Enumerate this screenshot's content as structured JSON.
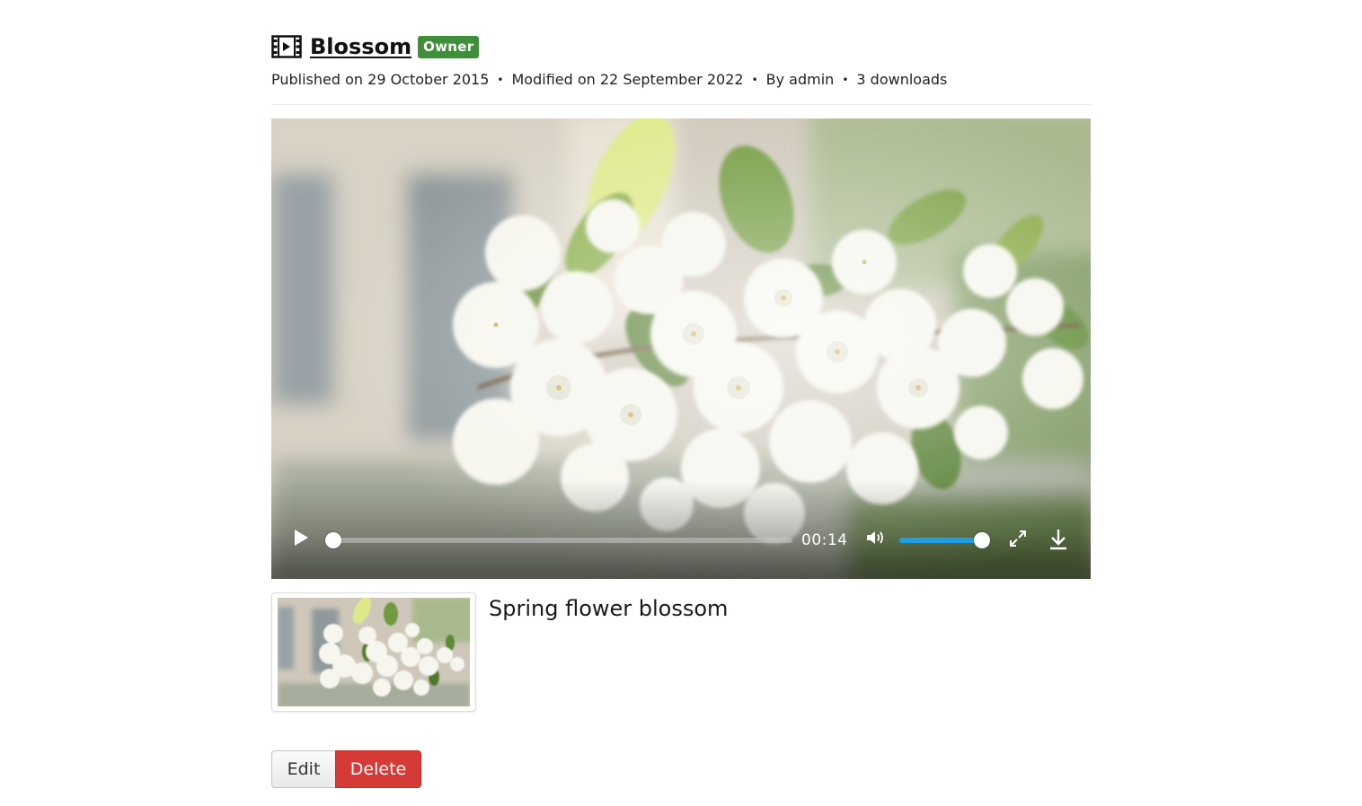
{
  "header": {
    "title": "Blossom",
    "badge": "Owner",
    "icon": "film-icon"
  },
  "meta": {
    "published": "Published on 29 October 2015",
    "modified": "Modified on 22 September 2022",
    "author": "By admin",
    "downloads": "3 downloads",
    "separator": "•"
  },
  "player": {
    "time": "00:14",
    "progress_fraction": 0.0,
    "volume_fraction": 1.0,
    "accent_color": "#1e9ee6",
    "controls": [
      "play-icon",
      "volume-icon",
      "fullscreen-icon",
      "download-icon"
    ]
  },
  "attachment": {
    "caption": "Spring flower blossom"
  },
  "actions": {
    "edit_label": "Edit",
    "delete_label": "Delete",
    "delete_color": "#d63a36"
  },
  "colors": {
    "badge": "#3f8f3a"
  }
}
